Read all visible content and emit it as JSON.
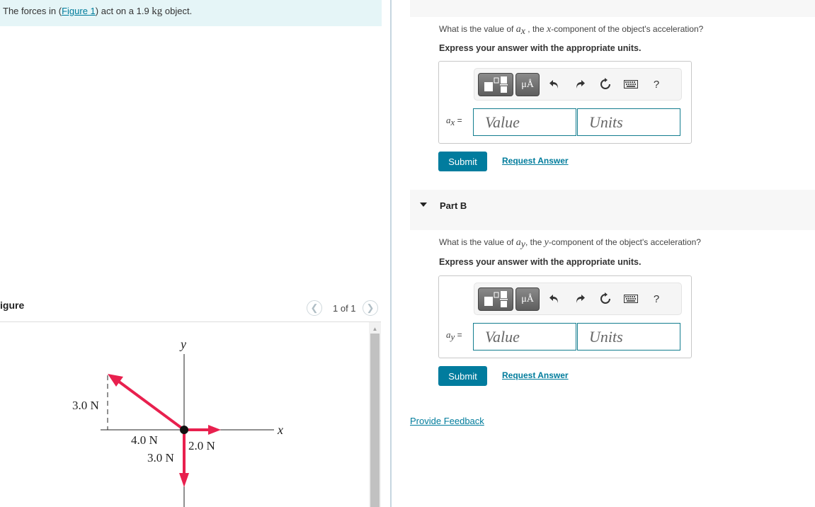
{
  "intro": {
    "prefix": "The forces in (",
    "figure_link": "Figure 1",
    "suffix_before_unit": ") act on a 1.9 ",
    "unit": "kg",
    "suffix": " object."
  },
  "figure_panel": {
    "title": "igure",
    "pagination": "1 of 1",
    "prev_icon": "chevron-left-icon",
    "next_icon": "chevron-right-icon",
    "figure": {
      "axis_x": "x",
      "axis_y": "y",
      "forces": [
        {
          "name": "diagonal",
          "components": {
            "x": "4.0 N",
            "y": "3.0 N"
          },
          "direction": "up-left"
        },
        {
          "name": "right",
          "label": "2.0 N",
          "direction": "+x"
        },
        {
          "name": "down",
          "label": "3.0 N",
          "direction": "-y"
        }
      ],
      "labels": {
        "diag_vertical": "3.0 N",
        "diag_horizontal": "4.0 N",
        "right_force": "2.0 N",
        "down_force": "3.0 N"
      },
      "arrow_color": "#e8204e"
    }
  },
  "part_a": {
    "question_prefix": "What is the value of ",
    "question_var": "a",
    "question_var_sub": "x",
    "question_mid": " , the ",
    "question_comp": "x",
    "question_suffix": "-component of the object's acceleration?",
    "instruction": "Express your answer with the appropriate units.",
    "var_label": "a",
    "var_sub": "x",
    "equals": " =",
    "value_placeholder": "Value",
    "units_placeholder": "Units",
    "submit_label": "Submit",
    "request_answer_label": "Request Answer"
  },
  "part_b": {
    "header": "Part B",
    "question_prefix": "What is the value of ",
    "question_var": "a",
    "question_var_sub": "y",
    "question_mid": ", the ",
    "question_comp": "y",
    "question_suffix": "-component of the object's acceleration?",
    "instruction": "Express your answer with the appropriate units.",
    "var_label": "a",
    "var_sub": "y",
    "equals": " =",
    "value_placeholder": "Value",
    "units_placeholder": "Units",
    "submit_label": "Submit",
    "request_answer_label": "Request Answer"
  },
  "toolbar": {
    "units_button": "μÅ",
    "help": "?",
    "icons": [
      "templates-icon",
      "units-icon",
      "undo-icon",
      "redo-icon",
      "reset-icon",
      "keyboard-icon",
      "help-icon"
    ]
  },
  "feedback_link": "Provide Feedback",
  "colors": {
    "accent": "#017c9e",
    "link": "#007c9c",
    "intro_bg": "#e5f5f7",
    "input_border": "#137d8f",
    "arrow": "#e8204e"
  }
}
